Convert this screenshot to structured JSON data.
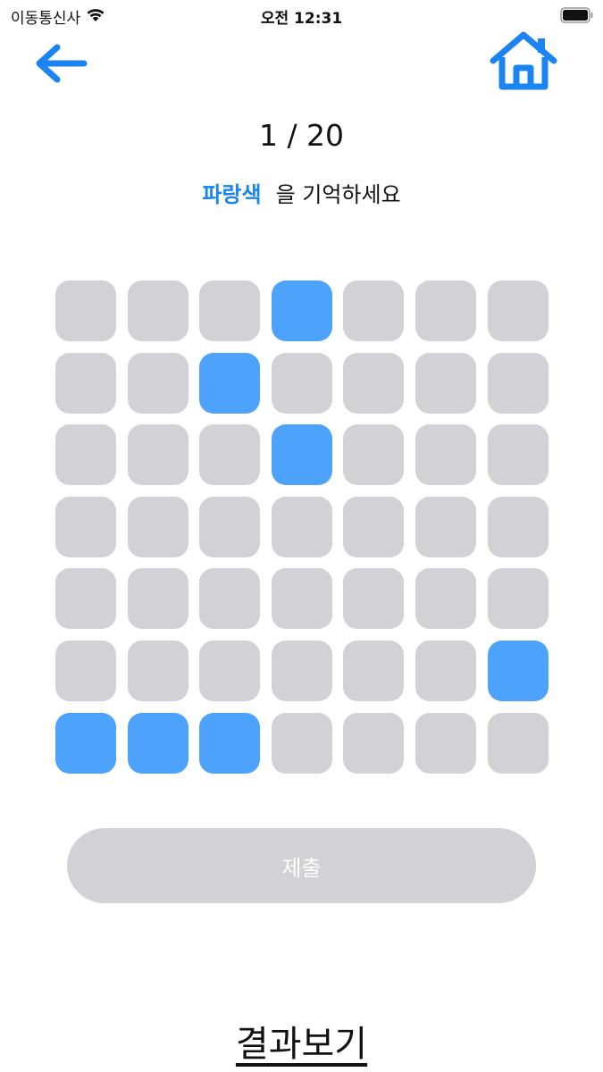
{
  "status_bar": {
    "carrier": "이동통신사",
    "time": "오전 12:31",
    "wifi_icon": "wifi-icon",
    "battery_icon": "battery-icon"
  },
  "nav": {
    "back_icon": "arrow-left-icon",
    "home_icon": "house-icon",
    "accent_color": "#1a84f0"
  },
  "progress": {
    "text": "1 / 20",
    "current": 1,
    "total": 20
  },
  "instruction": {
    "color_word": "파랑색",
    "rest": "을 기억하세요"
  },
  "grid": {
    "rows": 7,
    "cols": 7,
    "highlight_color": "#4da3fb",
    "default_color": "#d1d1d6",
    "cells": [
      [
        0,
        0,
        0,
        1,
        0,
        0,
        0
      ],
      [
        0,
        0,
        1,
        0,
        0,
        0,
        0
      ],
      [
        0,
        0,
        0,
        1,
        0,
        0,
        0
      ],
      [
        0,
        0,
        0,
        0,
        0,
        0,
        0
      ],
      [
        0,
        0,
        0,
        0,
        0,
        0,
        0
      ],
      [
        0,
        0,
        0,
        0,
        0,
        0,
        1
      ],
      [
        1,
        1,
        1,
        0,
        0,
        0,
        0
      ]
    ]
  },
  "submit": {
    "label": "제출"
  },
  "results": {
    "label": "결과보기"
  }
}
